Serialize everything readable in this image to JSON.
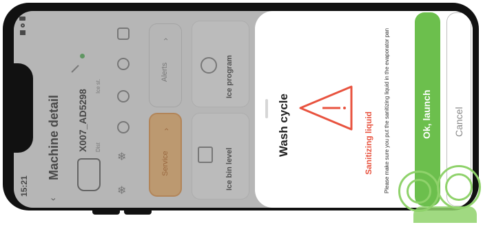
{
  "status_bar": {
    "time": "15:21"
  },
  "header": {
    "back_icon": "chevron-left-icon",
    "title": "Machine detail"
  },
  "machine": {
    "name": "X007_AD5298",
    "status_dot_color": "#4caf50",
    "meta_1": "Dist",
    "meta_2": "Ice st."
  },
  "tabs": {
    "service_label": "Service",
    "alerts_label": "Alerts"
  },
  "tiles": {
    "ice_bin_level": "Ice bin level",
    "ice_program": "Ice program"
  },
  "sheet": {
    "title": "Wash cycle",
    "warning_title": "Sanitizing liquid",
    "description": "Please make sure you put the sanitizing liquid in the evaporator pan",
    "ok_label": "Ok, launch",
    "cancel_label": "Cancel",
    "accent_color": "#6cbf4d",
    "warning_color": "#e8533f"
  }
}
